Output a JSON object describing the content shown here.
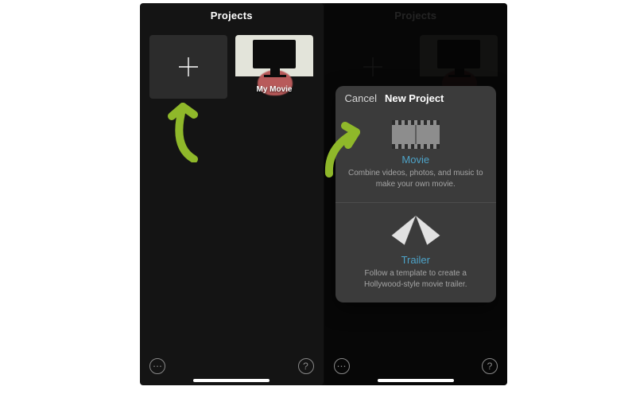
{
  "leftScreen": {
    "title": "Projects",
    "projectThumbLabel": "My Movie",
    "ellipsisGlyph": "⋯",
    "helpGlyph": "?"
  },
  "rightScreen": {
    "title": "Projects",
    "ellipsisGlyph": "⋯",
    "helpGlyph": "?",
    "dialog": {
      "cancel": "Cancel",
      "title": "New Project",
      "movieTitle": "Movie",
      "movieDesc": "Combine videos, photos, and music to make your own movie.",
      "trailerTitle": "Trailer",
      "trailerDesc": "Follow a template to create a Hollywood-style movie trailer."
    }
  },
  "colors": {
    "arrow": "#8fb82a"
  }
}
